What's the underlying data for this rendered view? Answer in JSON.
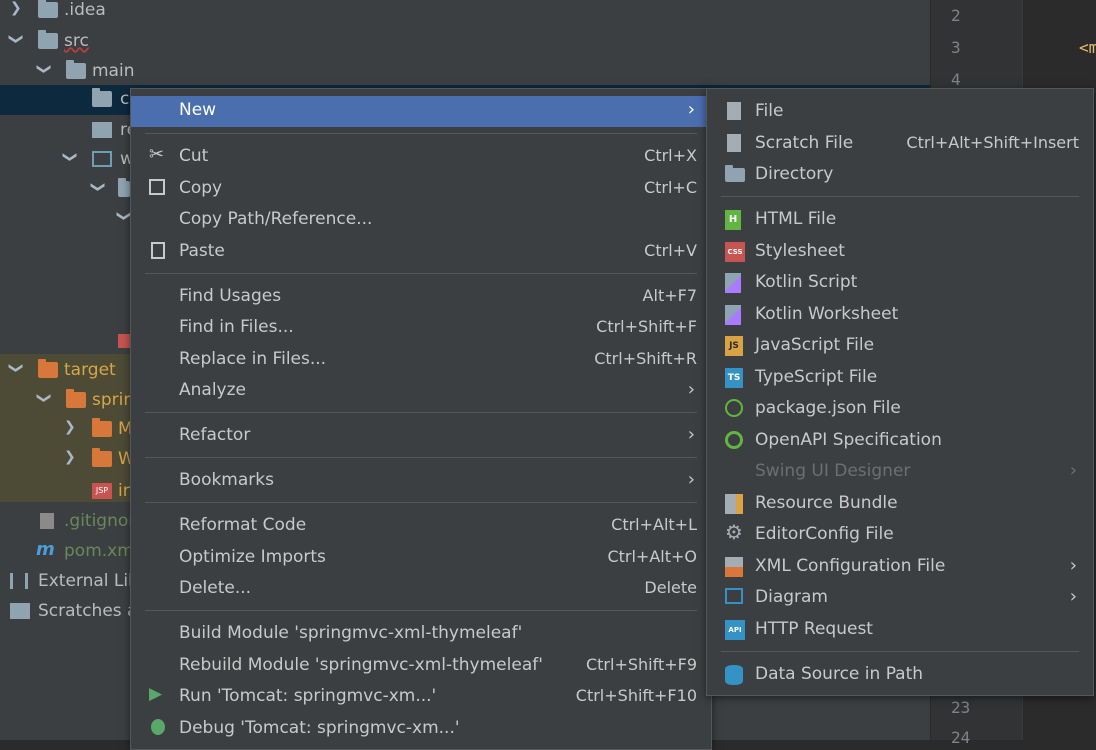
{
  "tree": {
    "rows": [
      {
        "label": ".idea"
      },
      {
        "label": "src"
      },
      {
        "label": "main"
      },
      {
        "label": "c"
      },
      {
        "label": "re"
      },
      {
        "label": "w"
      },
      {
        "label": "target"
      },
      {
        "label": "sprin"
      },
      {
        "label": "M"
      },
      {
        "label": "W"
      },
      {
        "label": "in"
      },
      {
        "label": ".gitignor"
      },
      {
        "label": "pom.xm"
      },
      {
        "label": "External Lib"
      },
      {
        "label": "Scratches a"
      }
    ]
  },
  "gutter": {
    "lines": [
      "2",
      "3",
      "4",
      "23",
      "24"
    ]
  },
  "editor": {
    "snippet": "<m"
  },
  "main_menu": {
    "items": [
      {
        "label": "New",
        "shortcut": "",
        "submenu": true
      },
      {
        "label": "Cut",
        "shortcut": "Ctrl+X"
      },
      {
        "label": "Copy",
        "shortcut": "Ctrl+C"
      },
      {
        "label": "Copy Path/Reference...",
        "shortcut": ""
      },
      {
        "label": "Paste",
        "shortcut": "Ctrl+V"
      },
      {
        "label": "Find Usages",
        "shortcut": "Alt+F7"
      },
      {
        "label": "Find in Files...",
        "shortcut": "Ctrl+Shift+F"
      },
      {
        "label": "Replace in Files...",
        "shortcut": "Ctrl+Shift+R"
      },
      {
        "label": "Analyze",
        "shortcut": "",
        "submenu": true
      },
      {
        "label": "Refactor",
        "shortcut": "",
        "submenu": true
      },
      {
        "label": "Bookmarks",
        "shortcut": "",
        "submenu": true
      },
      {
        "label": "Reformat Code",
        "shortcut": "Ctrl+Alt+L"
      },
      {
        "label": "Optimize Imports",
        "shortcut": "Ctrl+Alt+O"
      },
      {
        "label": "Delete...",
        "shortcut": "Delete"
      },
      {
        "label": "Build Module 'springmvc-xml-thymeleaf'",
        "shortcut": ""
      },
      {
        "label": "Rebuild Module 'springmvc-xml-thymeleaf'",
        "shortcut": "Ctrl+Shift+F9"
      },
      {
        "label": "Run 'Tomcat: springmvc-xm...'",
        "shortcut": "Ctrl+Shift+F10"
      },
      {
        "label": "Debug 'Tomcat: springmvc-xm...'",
        "shortcut": ""
      }
    ]
  },
  "sub_menu": {
    "items": [
      {
        "label": "File",
        "shortcut": ""
      },
      {
        "label": "Scratch File",
        "shortcut": "Ctrl+Alt+Shift+Insert"
      },
      {
        "label": "Directory",
        "shortcut": ""
      },
      {
        "label": "HTML File",
        "shortcut": ""
      },
      {
        "label": "Stylesheet",
        "shortcut": ""
      },
      {
        "label": "Kotlin Script",
        "shortcut": ""
      },
      {
        "label": "Kotlin Worksheet",
        "shortcut": ""
      },
      {
        "label": "JavaScript File",
        "shortcut": ""
      },
      {
        "label": "TypeScript File",
        "shortcut": ""
      },
      {
        "label": "package.json File",
        "shortcut": ""
      },
      {
        "label": "OpenAPI Specification",
        "shortcut": ""
      },
      {
        "label": "Swing UI Designer",
        "shortcut": "",
        "disabled": true
      },
      {
        "label": "Resource Bundle",
        "shortcut": ""
      },
      {
        "label": "EditorConfig File",
        "shortcut": ""
      },
      {
        "label": "XML Configuration File",
        "shortcut": ""
      },
      {
        "label": "Diagram",
        "shortcut": ""
      },
      {
        "label": "HTTP Request",
        "shortcut": ""
      },
      {
        "label": "Data Source in Path",
        "shortcut": ""
      }
    ]
  },
  "icon_badges": {
    "html": "H",
    "css": "CSS",
    "js": "JS",
    "ts": "TS",
    "api": "API",
    "jsp": "JSP",
    "maven": "m"
  },
  "colors": {
    "menu_bg": "#3c3f41",
    "highlight": "#4b6eaf",
    "tree_bg": "#3c3f41",
    "target_bg": "#4d4a36",
    "orange_folder": "#d8773a"
  }
}
